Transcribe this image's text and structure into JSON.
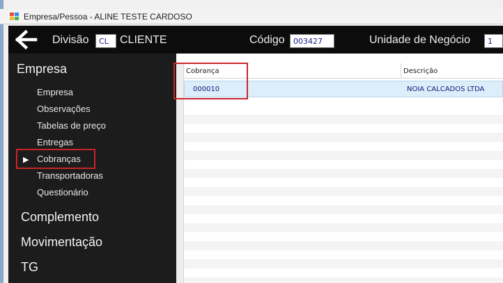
{
  "window": {
    "title": "Empresa/Pessoa - ALINE TESTE CARDOSO"
  },
  "header": {
    "division_label": "Divisão",
    "division_value": "CL",
    "division_name": "CLIENTE",
    "code_label": "Código",
    "code_value": "003427",
    "business_unit_label": "Unidade de Negócio",
    "business_unit_value": "1"
  },
  "sidebar": {
    "heading": "Empresa",
    "items": [
      {
        "label": "Empresa"
      },
      {
        "label": "Observações"
      },
      {
        "label": "Tabelas de preço"
      },
      {
        "label": "Entregas"
      },
      {
        "label": "Cobranças",
        "selected": true
      },
      {
        "label": "Transportadoras"
      },
      {
        "label": "Questionário"
      }
    ],
    "sections": [
      {
        "label": "Complemento"
      },
      {
        "label": "Movimentação"
      },
      {
        "label": "TG"
      }
    ]
  },
  "grid": {
    "columns": [
      "Cobrança",
      "Descrição"
    ],
    "rows": [
      {
        "cobranca": "000010",
        "descricao": "NOIA CALCADOS LTDA"
      }
    ]
  },
  "colors": {
    "header_bg": "#0c0c0c",
    "sidebar_bg": "#1c1c1c",
    "highlight_border": "#c8252a",
    "selected_row_bg": "#ddeefa",
    "cell_text": "#17177a"
  },
  "icons": {
    "back": "arrow-left-icon",
    "app": "app-window-icon",
    "selected_marker": "triangle-right-icon"
  }
}
